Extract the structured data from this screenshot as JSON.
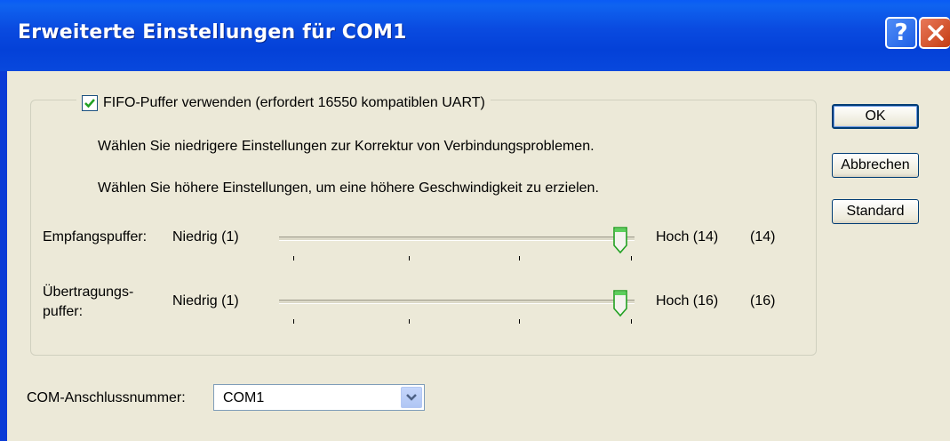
{
  "window": {
    "title": "Erweiterte Einstellungen für COM1",
    "help_label": "?",
    "close_label": "✕"
  },
  "fifo": {
    "checked": true,
    "check_glyph": "✔",
    "label": "FIFO-Puffer verwenden (erfordert 16550 kompatiblen UART)"
  },
  "hints": {
    "lower": "Wählen Sie niedrigere Einstellungen zur Korrektur von Verbindungsproblemen.",
    "higher": "Wählen Sie höhere Einstellungen, um eine höhere Geschwindigkeit zu erzielen."
  },
  "receive": {
    "label": "Empfangspuffer:",
    "min_label": "Niedrig (1)",
    "max_label": "Hoch (14)",
    "value_label": "(14)",
    "min": 1,
    "max": 14,
    "value": 14
  },
  "transmit": {
    "label_line1": "Übertragungs-",
    "label_line2": "puffer:",
    "min_label": "Niedrig (1)",
    "max_label": "Hoch (16)",
    "value_label": "(16)",
    "min": 1,
    "max": 16,
    "value": 16
  },
  "buttons": {
    "ok": "OK",
    "cancel": "Abbrechen",
    "default": "Standard"
  },
  "com_port": {
    "label": "COM-Anschlussnummer:",
    "value": "COM1"
  },
  "icons": {
    "help": "question-mark-icon",
    "close": "close-x-icon",
    "check": "checkmark-icon",
    "dropdown": "chevron-down-icon",
    "slider_thumb": "slider-thumb-icon"
  },
  "colors": {
    "titlebar": "#0a4be0",
    "client_bg": "#ece9d8",
    "close_button": "#c43c12",
    "help_button": "#1f5fe6",
    "button_border": "#003c74",
    "check": "#21a121",
    "thumb_accent": "#21a121"
  }
}
